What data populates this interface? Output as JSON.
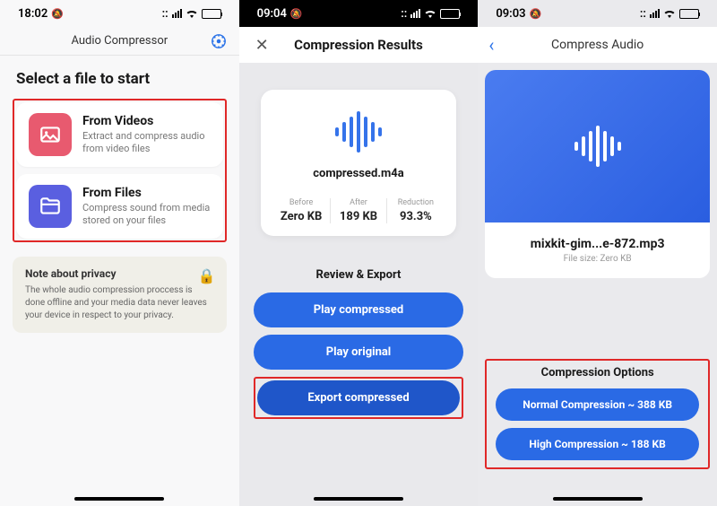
{
  "screen1": {
    "time": "18:02",
    "header_title": "Audio Compressor",
    "heading": "Select a file to start",
    "cards": [
      {
        "title": "From Videos",
        "desc": "Extract and compress audio from video files"
      },
      {
        "title": "From Files",
        "desc": "Compress sound from media stored on your files"
      }
    ],
    "privacy_title": "Note about privacy",
    "privacy_text": "The whole audio compression proccess is done offline and your media data never leaves your device in respect to your privacy."
  },
  "screen2": {
    "time": "09:04",
    "header_title": "Compression Results",
    "filename": "compressed.m4a",
    "stats": [
      {
        "label": "Before",
        "value": "Zero KB"
      },
      {
        "label": "After",
        "value": "189 KB"
      },
      {
        "label": "Reduction",
        "value": "93.3%"
      }
    ],
    "section_title": "Review & Export",
    "buttons": {
      "play_compressed": "Play compressed",
      "play_original": "Play original",
      "export": "Export compressed"
    }
  },
  "screen3": {
    "time": "09:03",
    "header_title": "Compress Audio",
    "filename": "mixkit-gim...e-872.mp3",
    "filesize": "File size: Zero KB",
    "options_title": "Compression Options",
    "buttons": {
      "normal": "Normal Compression ~ 388 KB",
      "high": "High Compression ~ 188 KB"
    }
  }
}
